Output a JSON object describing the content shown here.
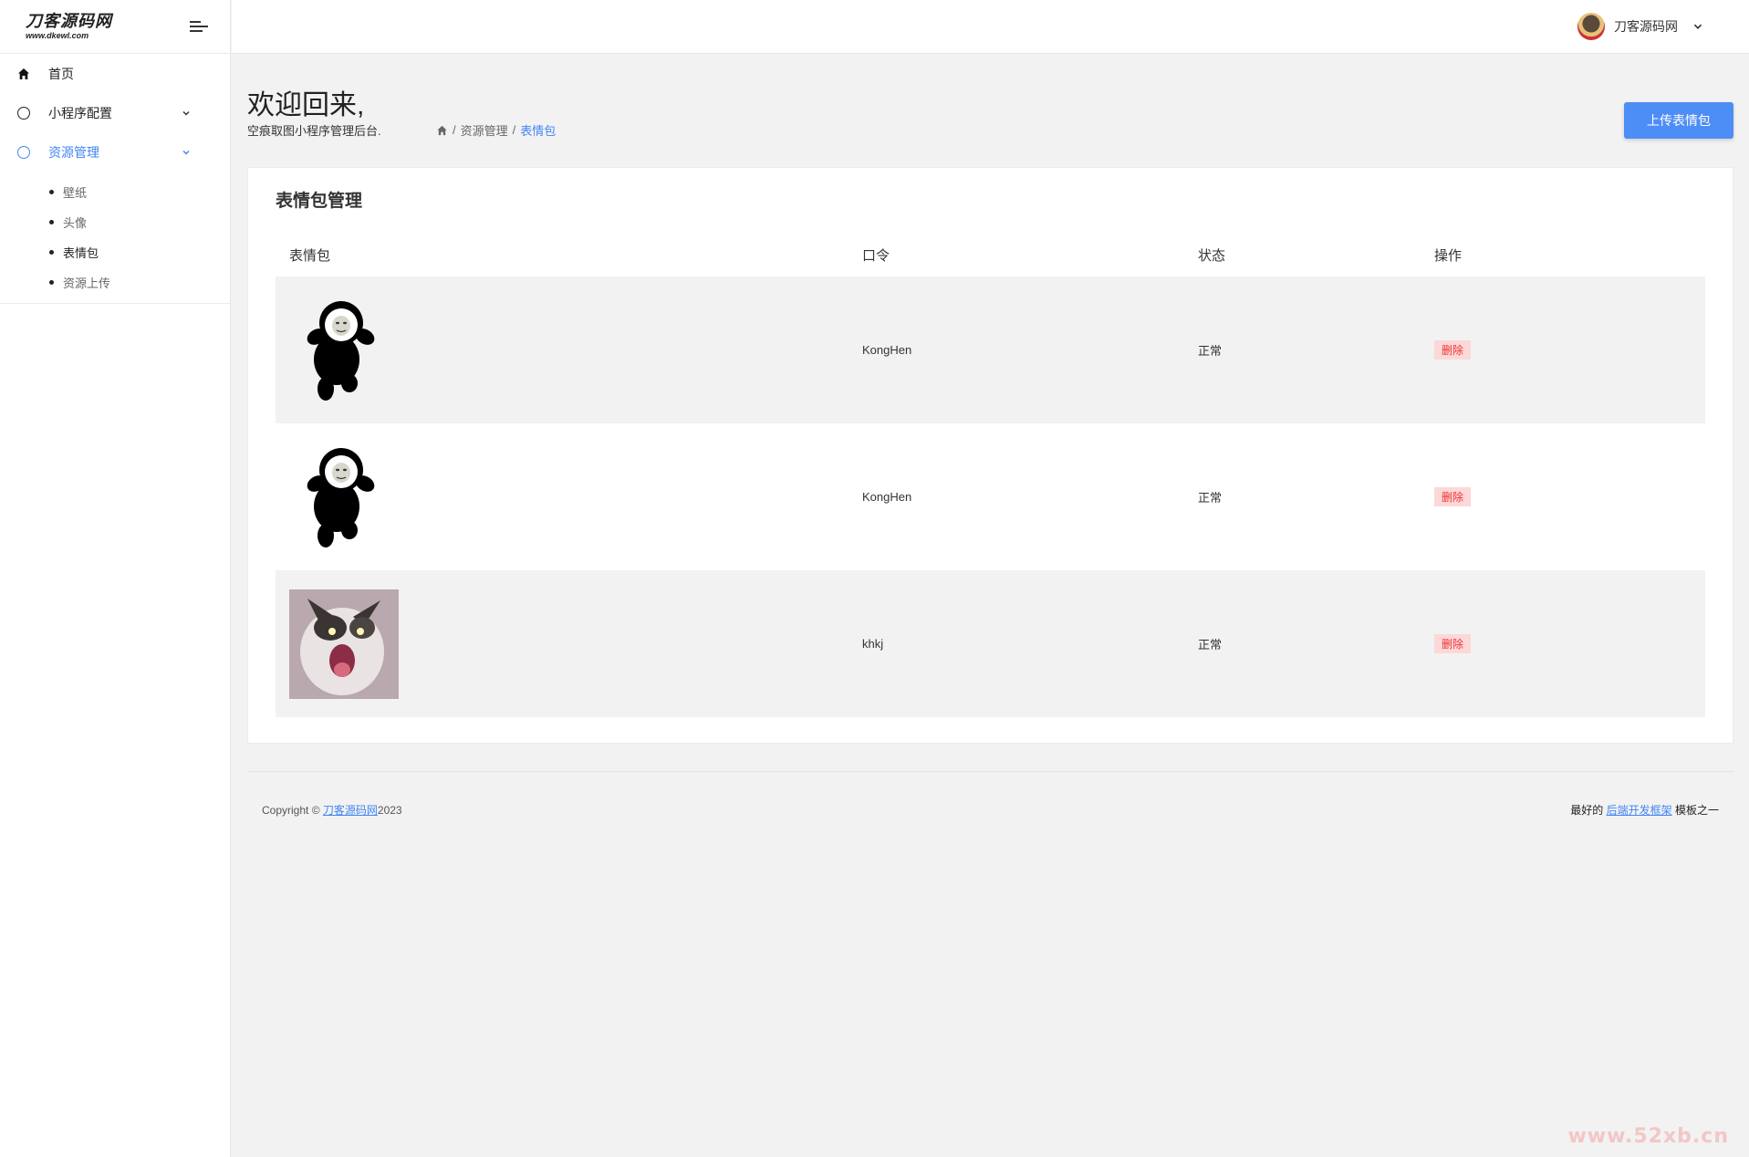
{
  "logo": {
    "title": "刀客源码网",
    "subtitle": "www.dkewl.com"
  },
  "sidebar": {
    "items": [
      {
        "label": "首页",
        "icon": "home-icon"
      },
      {
        "label": "小程序配置",
        "icon": "circle-icon"
      },
      {
        "label": "资源管理",
        "icon": "circle-icon"
      }
    ],
    "submenu": [
      {
        "label": "壁纸"
      },
      {
        "label": "头像"
      },
      {
        "label": "表情包"
      },
      {
        "label": "资源上传"
      }
    ]
  },
  "topbar": {
    "user_name": "刀客源码网"
  },
  "header": {
    "welcome": "欢迎回来,",
    "subtitle": "空痕取图小程序管理后台.",
    "breadcrumb": [
      "资源管理",
      "表情包"
    ],
    "upload_label": "上传表情包"
  },
  "card": {
    "title": "表情包管理",
    "columns": [
      "表情包",
      "口令",
      "状态",
      "操作"
    ],
    "rows": [
      {
        "image": "panda-meme",
        "command": "KongHen",
        "status": "正常",
        "action": "删除"
      },
      {
        "image": "panda-meme",
        "command": "KongHen",
        "status": "正常",
        "action": "删除"
      },
      {
        "image": "cat-meme",
        "command": "khkj",
        "status": "正常",
        "action": "删除"
      }
    ]
  },
  "footer": {
    "copyright_prefix": "Copyright ©",
    "copyright_link": "刀客源码网",
    "copyright_year": "2023",
    "right_prefix": "最好的",
    "right_link": "后端开发框架",
    "right_suffix": "模板之一"
  },
  "watermark": "www.52xb.cn",
  "colors": {
    "accent": "#4285f4",
    "button": "#4d8df6",
    "danger": "#e33333",
    "danger_bg": "#fdd8d8"
  }
}
